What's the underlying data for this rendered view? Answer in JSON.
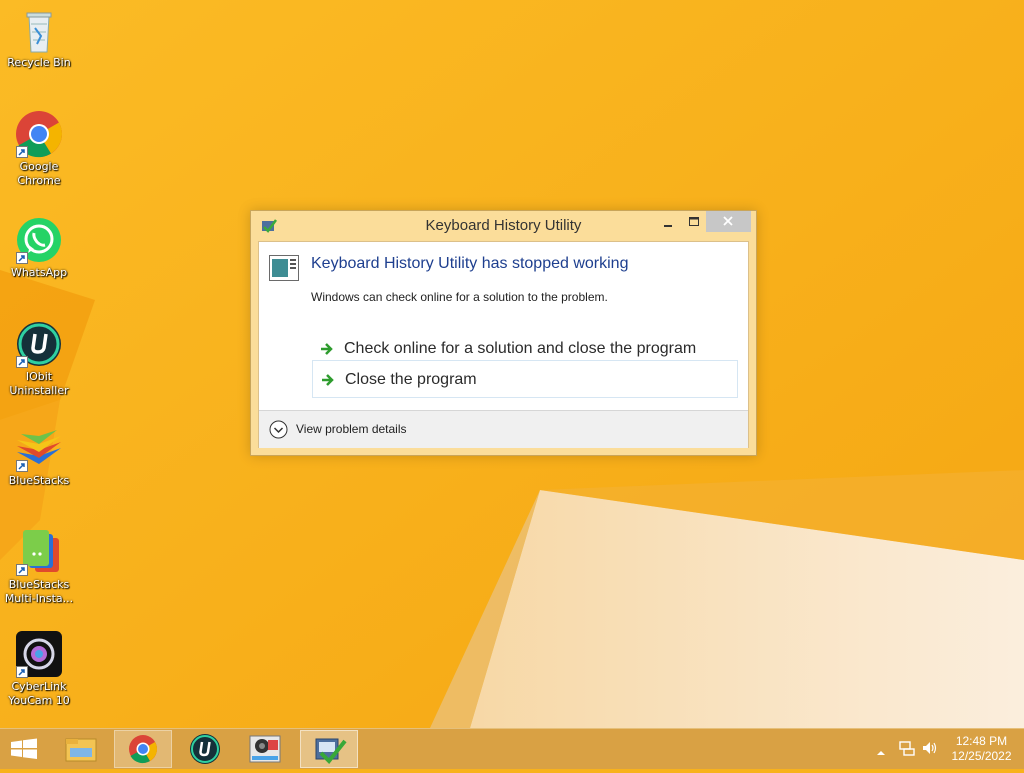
{
  "desktop": {
    "icons": [
      {
        "label": "Recycle Bin",
        "icon": "recycle-bin-icon"
      },
      {
        "label": "Google\nChrome",
        "icon": "chrome-icon"
      },
      {
        "label": "WhatsApp",
        "icon": "whatsapp-icon"
      },
      {
        "label": "IObit\nUninstaller",
        "icon": "iobit-uninstaller-icon"
      },
      {
        "label": "BlueStacks",
        "icon": "bluestacks-icon"
      },
      {
        "label": "BlueStacks\nMulti-Insta...",
        "icon": "bluestacks-multi-instance-icon"
      },
      {
        "label": "CyberLink\nYouCam 10",
        "icon": "cyberlink-youcam-icon"
      }
    ]
  },
  "dialog": {
    "title": "Keyboard History Utility",
    "heading": "Keyboard History Utility has stopped working",
    "message": "Windows can check online for a solution to the problem.",
    "options": [
      {
        "label": "Check online for a solution and close the program"
      },
      {
        "label": "Close the program"
      }
    ],
    "details_label": "View problem details"
  },
  "taskbar": {
    "items": [
      "start-icon",
      "file-explorer-icon",
      "chrome-icon",
      "iobit-uninstaller-icon",
      "media-app-icon",
      "keyboard-history-utility-icon"
    ],
    "clock": {
      "time": "12:48 PM",
      "date": "12/25/2022"
    }
  },
  "colors": {
    "desktop_background": "#f8b21c",
    "dialog_frame": "#fbdd9a",
    "heading_text": "#1e3f8f",
    "taskbar": "#d6a048"
  }
}
